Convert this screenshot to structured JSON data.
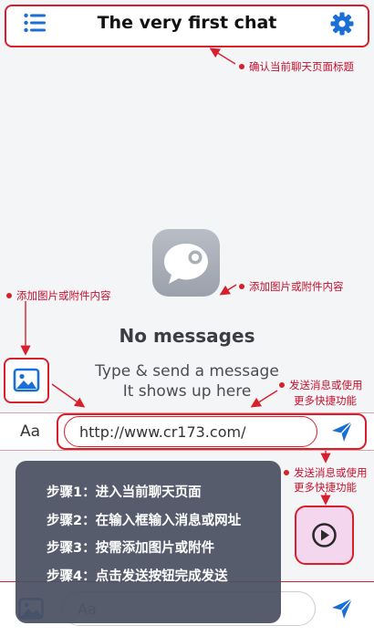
{
  "header": {
    "title": "The very first chat",
    "note": "确认当前聊天页面标题"
  },
  "empty_state": {
    "icon": "chat-bubble-icon",
    "title": "No messages",
    "subtitle_line1": "Type & send a message",
    "subtitle_line2": "It shows up here"
  },
  "annotations": {
    "attach_left": "添加图片或附件内容",
    "attach_right": "添加图片或附件内容",
    "send_line1": "发送消息或使用",
    "send_line2": "更多快捷功能",
    "quick_line1": "发送消息或使用",
    "quick_line2": "更多快捷功能"
  },
  "composer": {
    "format_label": "Aa",
    "input_value": "http://www.cr173.com/"
  },
  "steps": [
    "步骤1：进入当前聊天页面",
    "步骤2：在输入框输入消息或网址",
    "步骤3：按需添加图片或附件",
    "步骤4：点击发送按钮完成发送"
  ],
  "bottom_composer": {
    "placeholder": "Aa"
  },
  "colors": {
    "accent_blue": "#1a6fd6",
    "annotation_red": "#d8202c",
    "steps_panel": "#4a5062",
    "quick_button_bg": "#f4d7ef"
  }
}
